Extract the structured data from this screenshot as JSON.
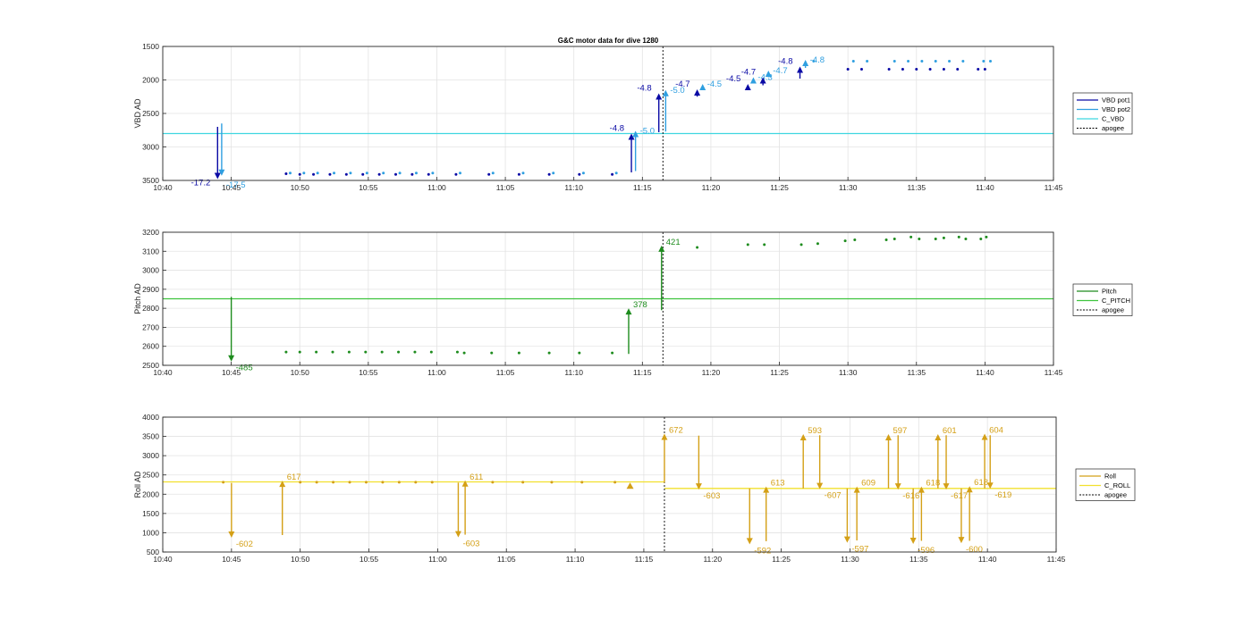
{
  "chart_data": [
    {
      "type": "line",
      "title": "G&C motor data for dive 1280",
      "ylabel": "VBD AD",
      "y_reversed": true,
      "ylim": [
        1500,
        3500
      ],
      "yticks": [
        "1500",
        "2000",
        "2500",
        "3000",
        "3500"
      ],
      "xlim": [
        "10:40",
        "11:45"
      ],
      "xticks": [
        "10:40",
        "10:45",
        "10:50",
        "10:55",
        "11:00",
        "11:05",
        "11:10",
        "11:15",
        "11:20",
        "11:25",
        "11:30",
        "11:35",
        "11:40",
        "11:45"
      ],
      "grid": true,
      "legend": [
        "VBD pot1",
        "VBD pot2",
        "C_VBD",
        "apogee"
      ],
      "legend_position": "right",
      "colors": {
        "pot1": "#0a0aa5",
        "pot2": "#2f9fe0",
        "cmd": "#3fd6e0",
        "apogee": "#000000"
      },
      "hlines": [
        {
          "series": "C_VBD",
          "y": 2800
        }
      ],
      "apogee_x": "11:16.5",
      "points": [
        {
          "series": "VBD pot1",
          "x": "10:49",
          "y": 3400
        },
        {
          "series": "VBD pot2",
          "x": "10:49.3",
          "y": 3390
        },
        {
          "series": "VBD pot1",
          "x": "10:50",
          "y": 3410
        },
        {
          "series": "VBD pot2",
          "x": "10:50.3",
          "y": 3390
        },
        {
          "series": "VBD pot1",
          "x": "10:51",
          "y": 3410
        },
        {
          "series": "VBD pot2",
          "x": "10:51.3",
          "y": 3390
        },
        {
          "series": "VBD pot1",
          "x": "10:52.2",
          "y": 3410
        },
        {
          "series": "VBD pot2",
          "x": "10:52.5",
          "y": 3390
        },
        {
          "series": "VBD pot1",
          "x": "10:53.4",
          "y": 3410
        },
        {
          "series": "VBD pot2",
          "x": "10:53.7",
          "y": 3390
        },
        {
          "series": "VBD pot1",
          "x": "10:54.6",
          "y": 3410
        },
        {
          "series": "VBD pot2",
          "x": "10:54.9",
          "y": 3390
        },
        {
          "series": "VBD pot1",
          "x": "10:55.8",
          "y": 3410
        },
        {
          "series": "VBD pot2",
          "x": "10:56.1",
          "y": 3390
        },
        {
          "series": "VBD pot1",
          "x": "10:57",
          "y": 3410
        },
        {
          "series": "VBD pot2",
          "x": "10:57.3",
          "y": 3390
        },
        {
          "series": "VBD pot1",
          "x": "10:58.2",
          "y": 3410
        },
        {
          "series": "VBD pot2",
          "x": "10:58.5",
          "y": 3390
        },
        {
          "series": "VBD pot1",
          "x": "10:59.4",
          "y": 3410
        },
        {
          "series": "VBD pot2",
          "x": "10:59.7",
          "y": 3390
        },
        {
          "series": "VBD pot1",
          "x": "11:01.4",
          "y": 3410
        },
        {
          "series": "VBD pot2",
          "x": "11:01.7",
          "y": 3390
        },
        {
          "series": "VBD pot1",
          "x": "11:03.8",
          "y": 3410
        },
        {
          "series": "VBD pot2",
          "x": "11:04.1",
          "y": 3390
        },
        {
          "series": "VBD pot1",
          "x": "11:06",
          "y": 3410
        },
        {
          "series": "VBD pot2",
          "x": "11:06.3",
          "y": 3390
        },
        {
          "series": "VBD pot1",
          "x": "11:08.2",
          "y": 3410
        },
        {
          "series": "VBD pot2",
          "x": "11:08.5",
          "y": 3390
        },
        {
          "series": "VBD pot1",
          "x": "11:10.4",
          "y": 3410
        },
        {
          "series": "VBD pot2",
          "x": "11:10.7",
          "y": 3390
        },
        {
          "series": "VBD pot1",
          "x": "11:12.8",
          "y": 3410
        },
        {
          "series": "VBD pot2",
          "x": "11:13.1",
          "y": 3390
        },
        {
          "series": "VBD pot1",
          "x": "11:33",
          "y": 1840
        },
        {
          "series": "VBD pot2",
          "x": "11:33.4",
          "y": 1720
        },
        {
          "series": "VBD pot1",
          "x": "11:34",
          "y": 1840
        },
        {
          "series": "VBD pot2",
          "x": "11:34.4",
          "y": 1720
        },
        {
          "series": "VBD pot1",
          "x": "11:35",
          "y": 1840
        },
        {
          "series": "VBD pot2",
          "x": "11:35.4",
          "y": 1720
        },
        {
          "series": "VBD pot1",
          "x": "11:36",
          "y": 1840
        },
        {
          "series": "VBD pot2",
          "x": "11:36.4",
          "y": 1720
        },
        {
          "series": "VBD pot1",
          "x": "11:37",
          "y": 1840
        },
        {
          "series": "VBD pot2",
          "x": "11:37.4",
          "y": 1720
        },
        {
          "series": "VBD pot1",
          "x": "11:38",
          "y": 1840
        },
        {
          "series": "VBD pot2",
          "x": "11:38.4",
          "y": 1720
        },
        {
          "series": "VBD pot1",
          "x": "11:39.5",
          "y": 1840
        },
        {
          "series": "VBD pot2",
          "x": "11:39.9",
          "y": 1720
        },
        {
          "series": "VBD pot1",
          "x": "11:40",
          "y": 1840
        },
        {
          "series": "VBD pot2",
          "x": "11:40.4",
          "y": 1720
        },
        {
          "series": "VBD pot1",
          "x": "11:30",
          "y": 1840
        },
        {
          "series": "VBD pot2",
          "x": "11:30.4",
          "y": 1720
        },
        {
          "series": "VBD pot1",
          "x": "11:31",
          "y": 1840
        },
        {
          "series": "VBD pot2",
          "x": "11:31.4",
          "y": 1720
        },
        {
          "series": "VBD pot2",
          "x": "11:27.5",
          "y": 1720
        }
      ],
      "moves": [
        {
          "series": "VBD pot1",
          "x": "10:44",
          "y_from": 2700,
          "y_to": 3480,
          "label": "-17.2"
        },
        {
          "series": "VBD pot2",
          "x": "10:44.3",
          "y_from": 2650,
          "y_to": 3430,
          "label": "-17.5"
        },
        {
          "series": "VBD pot1",
          "x": "11:14.2",
          "y_from": 3380,
          "y_to": 2800,
          "label": "-4.8"
        },
        {
          "series": "VBD pot2",
          "x": "11:14.5",
          "y_from": 3360,
          "y_to": 2760,
          "label": "-5.0"
        },
        {
          "series": "VBD pot1",
          "x": "11:16.2",
          "y_from": 2780,
          "y_to": 2200,
          "label": "-4.8"
        },
        {
          "series": "VBD pot2",
          "x": "11:16.7",
          "y_from": 2770,
          "y_to": 2150,
          "label": "-5.0"
        },
        {
          "series": "VBD pot1",
          "x": "11:19",
          "y_from": 2250,
          "y_to": 2140,
          "label": "-4.7"
        },
        {
          "series": "VBD pot2",
          "x": "11:19.4",
          "y_from": 2150,
          "y_to": 2060,
          "label": "-4.5"
        },
        {
          "series": "VBD pot1",
          "x": "11:22.7",
          "y_from": 2150,
          "y_to": 2060,
          "label": "-4.5"
        },
        {
          "series": "VBD pot2",
          "x": "11:23.1",
          "y_from": 2050,
          "y_to": 1960,
          "label": "-4.3"
        },
        {
          "series": "VBD pot1",
          "x": "11:23.8",
          "y_from": 2080,
          "y_to": 1960,
          "label": "-4.7"
        },
        {
          "series": "VBD pot2",
          "x": "11:24.2",
          "y_from": 1960,
          "y_to": 1860,
          "label": "-4.7"
        },
        {
          "series": "VBD pot1",
          "x": "11:26.5",
          "y_from": 1980,
          "y_to": 1800,
          "label": "-4.8"
        },
        {
          "series": "VBD pot2",
          "x": "11:26.9",
          "y_from": 1820,
          "y_to": 1700,
          "label": "-4.8"
        }
      ]
    },
    {
      "type": "line",
      "ylabel": "Pitch AD",
      "ylim": [
        2500,
        3200
      ],
      "yticks": [
        "2500",
        "2600",
        "2700",
        "2800",
        "2900",
        "3000",
        "3100",
        "3200"
      ],
      "xlim": [
        "10:40",
        "11:45"
      ],
      "xticks": [
        "10:40",
        "10:45",
        "10:50",
        "10:55",
        "11:00",
        "11:05",
        "11:10",
        "11:15",
        "11:20",
        "11:25",
        "11:30",
        "11:35",
        "11:40",
        "11:45"
      ],
      "grid": true,
      "legend": [
        "Pitch",
        "C_PITCH",
        "apogee"
      ],
      "legend_position": "right",
      "colors": {
        "pitch": "#1e8c1e",
        "cmd": "#3ec43e",
        "apogee": "#000000"
      },
      "hlines": [
        {
          "series": "C_PITCH",
          "y": 2850
        }
      ],
      "apogee_x": "11:16.5",
      "points": [
        {
          "x": "10:49",
          "y": 2570
        },
        {
          "x": "10:50",
          "y": 2570
        },
        {
          "x": "10:51.2",
          "y": 2570
        },
        {
          "x": "10:52.4",
          "y": 2570
        },
        {
          "x": "10:53.6",
          "y": 2570
        },
        {
          "x": "10:54.8",
          "y": 2570
        },
        {
          "x": "10:56",
          "y": 2570
        },
        {
          "x": "10:57.2",
          "y": 2570
        },
        {
          "x": "10:58.4",
          "y": 2570
        },
        {
          "x": "10:59.6",
          "y": 2570
        },
        {
          "x": "11:01.5",
          "y": 2570
        },
        {
          "x": "11:02",
          "y": 2565
        },
        {
          "x": "11:04",
          "y": 2565
        },
        {
          "x": "11:06",
          "y": 2565
        },
        {
          "x": "11:08.2",
          "y": 2565
        },
        {
          "x": "11:10.4",
          "y": 2565
        },
        {
          "x": "11:12.8",
          "y": 2565
        },
        {
          "x": "11:19",
          "y": 3120
        },
        {
          "x": "11:22.7",
          "y": 3135
        },
        {
          "x": "11:23.9",
          "y": 3135
        },
        {
          "x": "11:26.6",
          "y": 3135
        },
        {
          "x": "11:27.8",
          "y": 3140
        },
        {
          "x": "11:29.8",
          "y": 3155
        },
        {
          "x": "11:30.5",
          "y": 3160
        },
        {
          "x": "11:32.8",
          "y": 3160
        },
        {
          "x": "11:33.4",
          "y": 3165
        },
        {
          "x": "11:34.6",
          "y": 3175
        },
        {
          "x": "11:35.2",
          "y": 3165
        },
        {
          "x": "11:36.4",
          "y": 3165
        },
        {
          "x": "11:37",
          "y": 3170
        },
        {
          "x": "11:38.1",
          "y": 3175
        },
        {
          "x": "11:38.6",
          "y": 3165
        },
        {
          "x": "11:39.7",
          "y": 3165
        },
        {
          "x": "11:40.1",
          "y": 3175
        }
      ],
      "moves": [
        {
          "x": "10:45",
          "y_from": 2860,
          "y_to": 2520,
          "label": "-485"
        },
        {
          "x": "11:14",
          "y_from": 2560,
          "y_to": 2800,
          "label": "378"
        },
        {
          "x": "11:16.4",
          "y_from": 2790,
          "y_to": 3130,
          "label": "421"
        }
      ]
    },
    {
      "type": "line",
      "ylabel": "Roll AD",
      "ylim": [
        500,
        4000
      ],
      "yticks": [
        "500",
        "1000",
        "1500",
        "2000",
        "2500",
        "3000",
        "3500",
        "4000"
      ],
      "xlim": [
        "10:40",
        "11:45"
      ],
      "xticks": [
        "10:40",
        "10:45",
        "10:50",
        "10:55",
        "11:00",
        "11:05",
        "11:10",
        "11:15",
        "11:20",
        "11:25",
        "11:30",
        "11:35",
        "11:40",
        "11:45"
      ],
      "grid": true,
      "legend": [
        "Roll",
        "C_ROLL",
        "apogee"
      ],
      "legend_position": "right",
      "colors": {
        "roll": "#d4a017",
        "cmd": "#f2e02e",
        "apogee": "#000000"
      },
      "hlines": [
        {
          "series": "C_ROLL",
          "x_from": "10:40",
          "x_to": "11:16.5",
          "y": 2320
        },
        {
          "series": "C_ROLL",
          "x_from": "11:16.5",
          "x_to": "11:45",
          "y": 2150
        }
      ],
      "apogee_x": "11:16.5",
      "points": [
        {
          "x": "10:44.4",
          "y": 2310
        },
        {
          "x": "10:50",
          "y": 2310
        },
        {
          "x": "10:51.2",
          "y": 2310
        },
        {
          "x": "10:52.4",
          "y": 2310
        },
        {
          "x": "10:53.6",
          "y": 2310
        },
        {
          "x": "10:54.8",
          "y": 2310
        },
        {
          "x": "10:56",
          "y": 2310
        },
        {
          "x": "10:57.2",
          "y": 2310
        },
        {
          "x": "10:58.4",
          "y": 2310
        },
        {
          "x": "10:59.6",
          "y": 2310
        },
        {
          "x": "11:04",
          "y": 2310
        },
        {
          "x": "11:06.2",
          "y": 2310
        },
        {
          "x": "11:08.3",
          "y": 2310
        },
        {
          "x": "11:10.5",
          "y": 2310
        },
        {
          "x": "11:12.9",
          "y": 2310
        }
      ],
      "markers": [
        {
          "x": "11:14",
          "y": 2210
        }
      ],
      "moves": [
        {
          "x": "10:45",
          "y_from": 2290,
          "y_to": 870,
          "label": "-602"
        },
        {
          "x": "10:48.7",
          "y_from": 940,
          "y_to": 2350,
          "label": "617"
        },
        {
          "x": "11:01.5",
          "y_from": 2300,
          "y_to": 880,
          "label": "-603"
        },
        {
          "x": "11:02",
          "y_from": 950,
          "y_to": 2360,
          "label": "611"
        },
        {
          "x": "11:16.5",
          "y_from": 2300,
          "y_to": 3570,
          "label": "672"
        },
        {
          "x": "11:19",
          "y_from": 3520,
          "y_to": 2120,
          "label": "-603"
        },
        {
          "x": "11:22.7",
          "y_from": 2150,
          "y_to": 700,
          "label": "-592"
        },
        {
          "x": "11:23.9",
          "y_from": 780,
          "y_to": 2200,
          "label": "613"
        },
        {
          "x": "11:26.6",
          "y_from": 2150,
          "y_to": 3560,
          "label": "593"
        },
        {
          "x": "11:27.8",
          "y_from": 3530,
          "y_to": 2130,
          "label": "-607"
        },
        {
          "x": "11:29.8",
          "y_from": 2150,
          "y_to": 740,
          "label": "-597"
        },
        {
          "x": "11:30.5",
          "y_from": 800,
          "y_to": 2200,
          "label": "609"
        },
        {
          "x": "11:32.8",
          "y_from": 2150,
          "y_to": 3560,
          "label": "597"
        },
        {
          "x": "11:33.5",
          "y_from": 3530,
          "y_to": 2120,
          "label": "-616"
        },
        {
          "x": "11:34.6",
          "y_from": 2150,
          "y_to": 710,
          "label": "-596"
        },
        {
          "x": "11:35.2",
          "y_from": 790,
          "y_to": 2200,
          "label": "618"
        },
        {
          "x": "11:36.4",
          "y_from": 2150,
          "y_to": 3560,
          "label": "601"
        },
        {
          "x": "11:37",
          "y_from": 3530,
          "y_to": 2120,
          "label": "-617"
        },
        {
          "x": "11:38.1",
          "y_from": 2150,
          "y_to": 730,
          "label": "-600"
        },
        {
          "x": "11:38.7",
          "y_from": 790,
          "y_to": 2210,
          "label": "618"
        },
        {
          "x": "11:39.8",
          "y_from": 2150,
          "y_to": 3570,
          "label": "604"
        },
        {
          "x": "11:40.2",
          "y_from": 3530,
          "y_to": 2140,
          "label": "-619"
        }
      ]
    }
  ]
}
